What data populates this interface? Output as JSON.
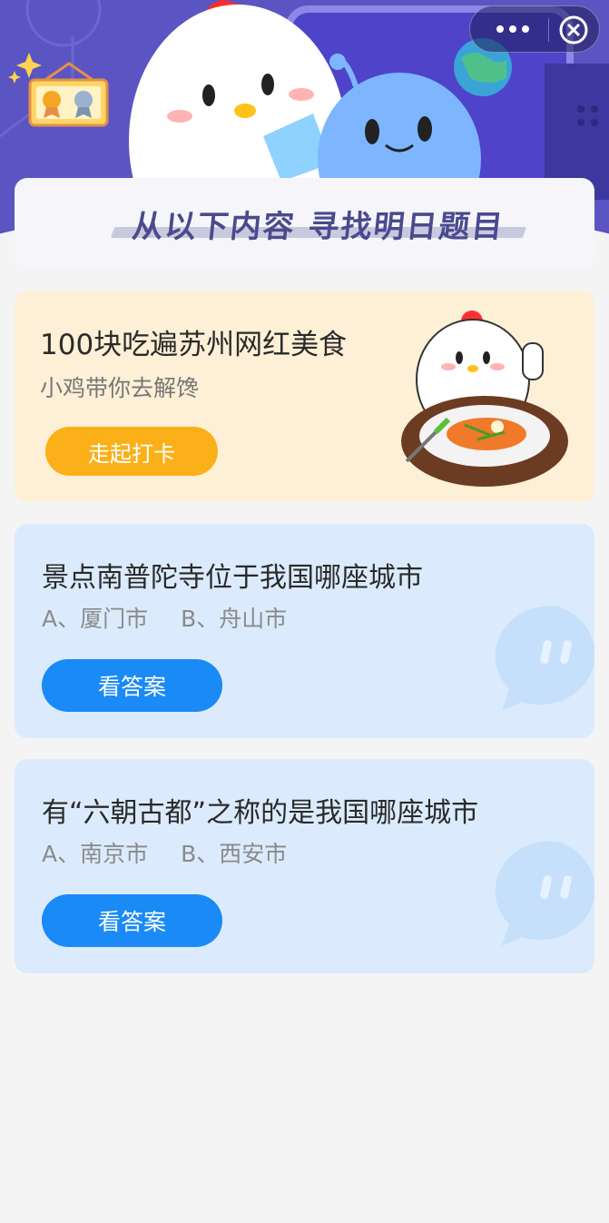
{
  "header": {
    "banner_title": "从以下内容  寻找明日题目",
    "colors": {
      "hero_bg": "#5a55c2",
      "banner_text": "#4a4a8e"
    }
  },
  "capsule": {
    "more_icon": "more-dots-icon",
    "close_icon": "close-circle-icon"
  },
  "food_card": {
    "title": "100块吃遍苏州网红美食",
    "subtitle": "小鸡带你去解馋",
    "button_label": "走起打卡",
    "colors": {
      "bg": "#fdf0d6",
      "button": "#fbb019"
    }
  },
  "questions": [
    {
      "title": "景点南普陀寺位于我国哪座城市",
      "option_a": "A、厦门市",
      "option_b": "B、舟山市",
      "button_label": "看答案"
    },
    {
      "title": "有“六朝古都”之称的是我国哪座城市",
      "option_a": "A、南京市",
      "option_b": "B、西安市",
      "button_label": "看答案"
    }
  ],
  "colors": {
    "question_bg": "#dbebfd",
    "answer_button": "#1a8af6",
    "page_bg": "#f4f4f5"
  }
}
